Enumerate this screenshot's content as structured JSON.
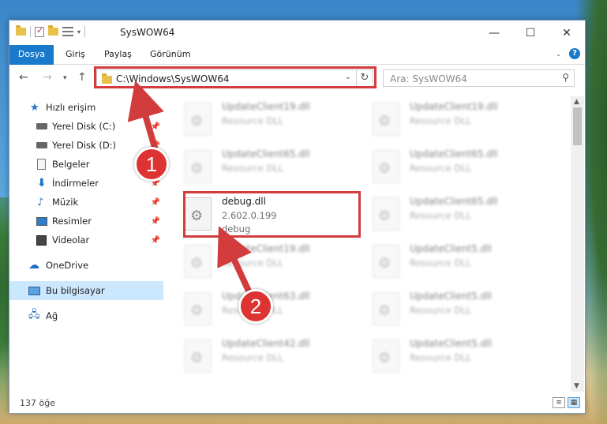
{
  "window": {
    "title": "SysWOW64"
  },
  "ribbon": {
    "tabs": [
      "Dosya",
      "Giriş",
      "Paylaş",
      "Görünüm"
    ]
  },
  "address": {
    "path": "C:\\Windows\\SysWOW64"
  },
  "search": {
    "placeholder": "Ara: SysWOW64"
  },
  "nav": {
    "quick_access": "Hızlı erişim",
    "items": [
      "Yerel Disk (C:)",
      "Yerel Disk (D:)",
      "Belgeler",
      "İndirmeler",
      "Müzik",
      "Resimler",
      "Videolar"
    ],
    "onedrive": "OneDrive",
    "this_pc": "Bu bilgisayar",
    "network": "Ağ"
  },
  "files": [
    {
      "name": "UpdateClient19.dll",
      "desc": "Resource DLL"
    },
    {
      "name": "UpdateClient19.dll",
      "desc": "Resource DLL"
    },
    {
      "name": "UpdateClient65.dll",
      "desc": "Resource DLL"
    },
    {
      "name": "UpdateClient65.dll",
      "desc": "Resource DLL"
    },
    {
      "name": "debug.dll",
      "version": "2.602.0.199",
      "desc": "debug"
    },
    {
      "name": "UpdateClient65.dll",
      "desc": "Resource DLL"
    },
    {
      "name": "UpdateClient19.dll",
      "desc": "Resource DLL"
    },
    {
      "name": "UpdateClient5.dll",
      "desc": "Resource DLL"
    },
    {
      "name": "UpdateClient63.dll",
      "desc": "Resource DLL"
    },
    {
      "name": "UpdateClient5.dll",
      "desc": "Resource DLL"
    },
    {
      "name": "UpdateClient42.dll",
      "desc": "Resource DLL"
    },
    {
      "name": "UpdateClient5.dll",
      "desc": "Resource DLL"
    }
  ],
  "status": {
    "count": "137 öğe"
  },
  "annotations": {
    "step1": "1",
    "step2": "2",
    "color": "#d23c3c"
  }
}
